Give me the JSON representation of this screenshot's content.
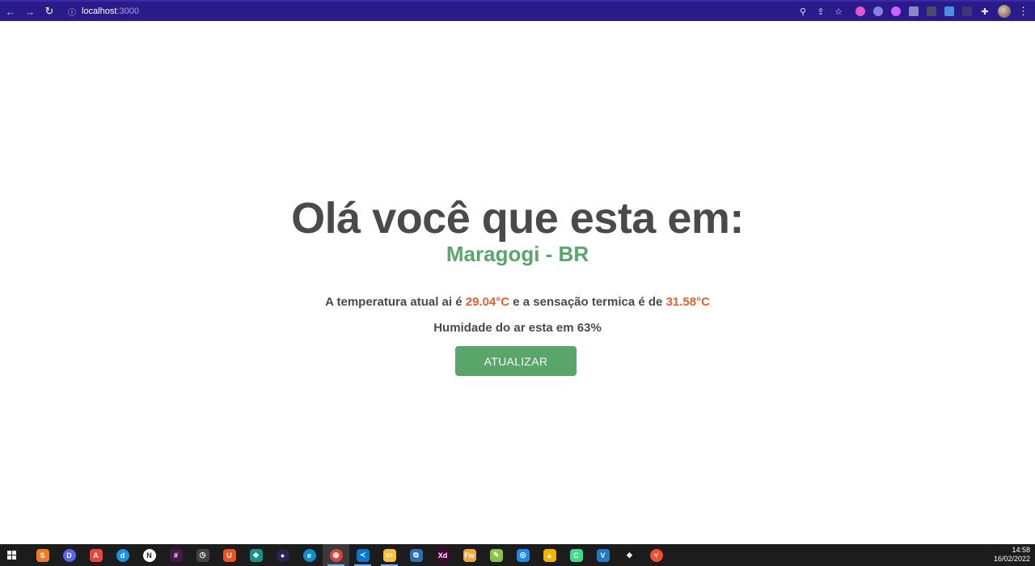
{
  "browser": {
    "url_host": "localhost",
    "url_port": ":3000",
    "nav_back_icon": "arrow-left-icon",
    "nav_forward_icon": "arrow-right-icon",
    "reload_icon": "reload-icon"
  },
  "page": {
    "greeting": "Olá você que esta em:",
    "location": "Maragogi - BR",
    "temp_prefix": "A temperatura atual ai é ",
    "temp_value": "29.04°C",
    "temp_middle": " e a sensação termica é de ",
    "feels_value": "31.58°C",
    "humidity": "Humidade do ar esta em 63%",
    "update_button": "ATUALIZAR"
  },
  "colors": {
    "chrome_bg": "#2a1a8a",
    "heading": "#4a4a4a",
    "accent_green": "#5aa66a",
    "highlight_orange": "#e0612f",
    "taskbar_bg": "#1c1c1c"
  },
  "taskbar": {
    "time": "14:58",
    "date": "16/02/2022",
    "apps": [
      {
        "name": "sublime-icon",
        "color": "#f47a20",
        "label": "S"
      },
      {
        "name": "discord-icon",
        "color": "#5865f2",
        "label": "D"
      },
      {
        "name": "anydesk-icon",
        "color": "#ef443b",
        "label": "A"
      },
      {
        "name": "docker-icon",
        "color": "#1d91e6",
        "label": "d"
      },
      {
        "name": "notion-icon",
        "color": "#ffffff",
        "label": "N"
      },
      {
        "name": "slack-icon",
        "color": "#4a154b",
        "label": "#"
      },
      {
        "name": "clock-app-icon",
        "color": "#444444",
        "label": "◷"
      },
      {
        "name": "ubuntu-icon",
        "color": "#e95420",
        "label": "U"
      },
      {
        "name": "git-kraken-icon",
        "color": "#179287",
        "label": "◆"
      },
      {
        "name": "eclipse-icon",
        "color": "#2c2255",
        "label": "●"
      },
      {
        "name": "edge-icon",
        "color": "#0f8fcf",
        "label": "e"
      },
      {
        "name": "chrome-icon",
        "color": "#db4437",
        "label": "◉"
      },
      {
        "name": "vscode-icon",
        "color": "#0078d4",
        "label": "≺"
      },
      {
        "name": "file-explorer-icon",
        "color": "#f3c13a",
        "label": "▭"
      },
      {
        "name": "cmd-icon",
        "color": "#2f6db5",
        "label": "⧉"
      },
      {
        "name": "adobe-xd-icon",
        "color": "#470137",
        "label": "Xd"
      },
      {
        "name": "fireworks-icon",
        "color": "#f2a93b",
        "label": "Fw"
      },
      {
        "name": "notepad-icon",
        "color": "#8bc34a",
        "label": "✎"
      },
      {
        "name": "browser2-icon",
        "color": "#1e88e5",
        "label": "◎"
      },
      {
        "name": "beekeeper-icon",
        "color": "#f5b400",
        "label": "▲"
      },
      {
        "name": "android-studio-icon",
        "color": "#3ddc84",
        "label": "C"
      },
      {
        "name": "virtualbox-icon",
        "color": "#1f7ac6",
        "label": "V"
      },
      {
        "name": "gitkraken2-icon",
        "color": "#1a1a1a",
        "label": "◈"
      },
      {
        "name": "git-icon",
        "color": "#f05032",
        "label": "⑂"
      }
    ]
  }
}
